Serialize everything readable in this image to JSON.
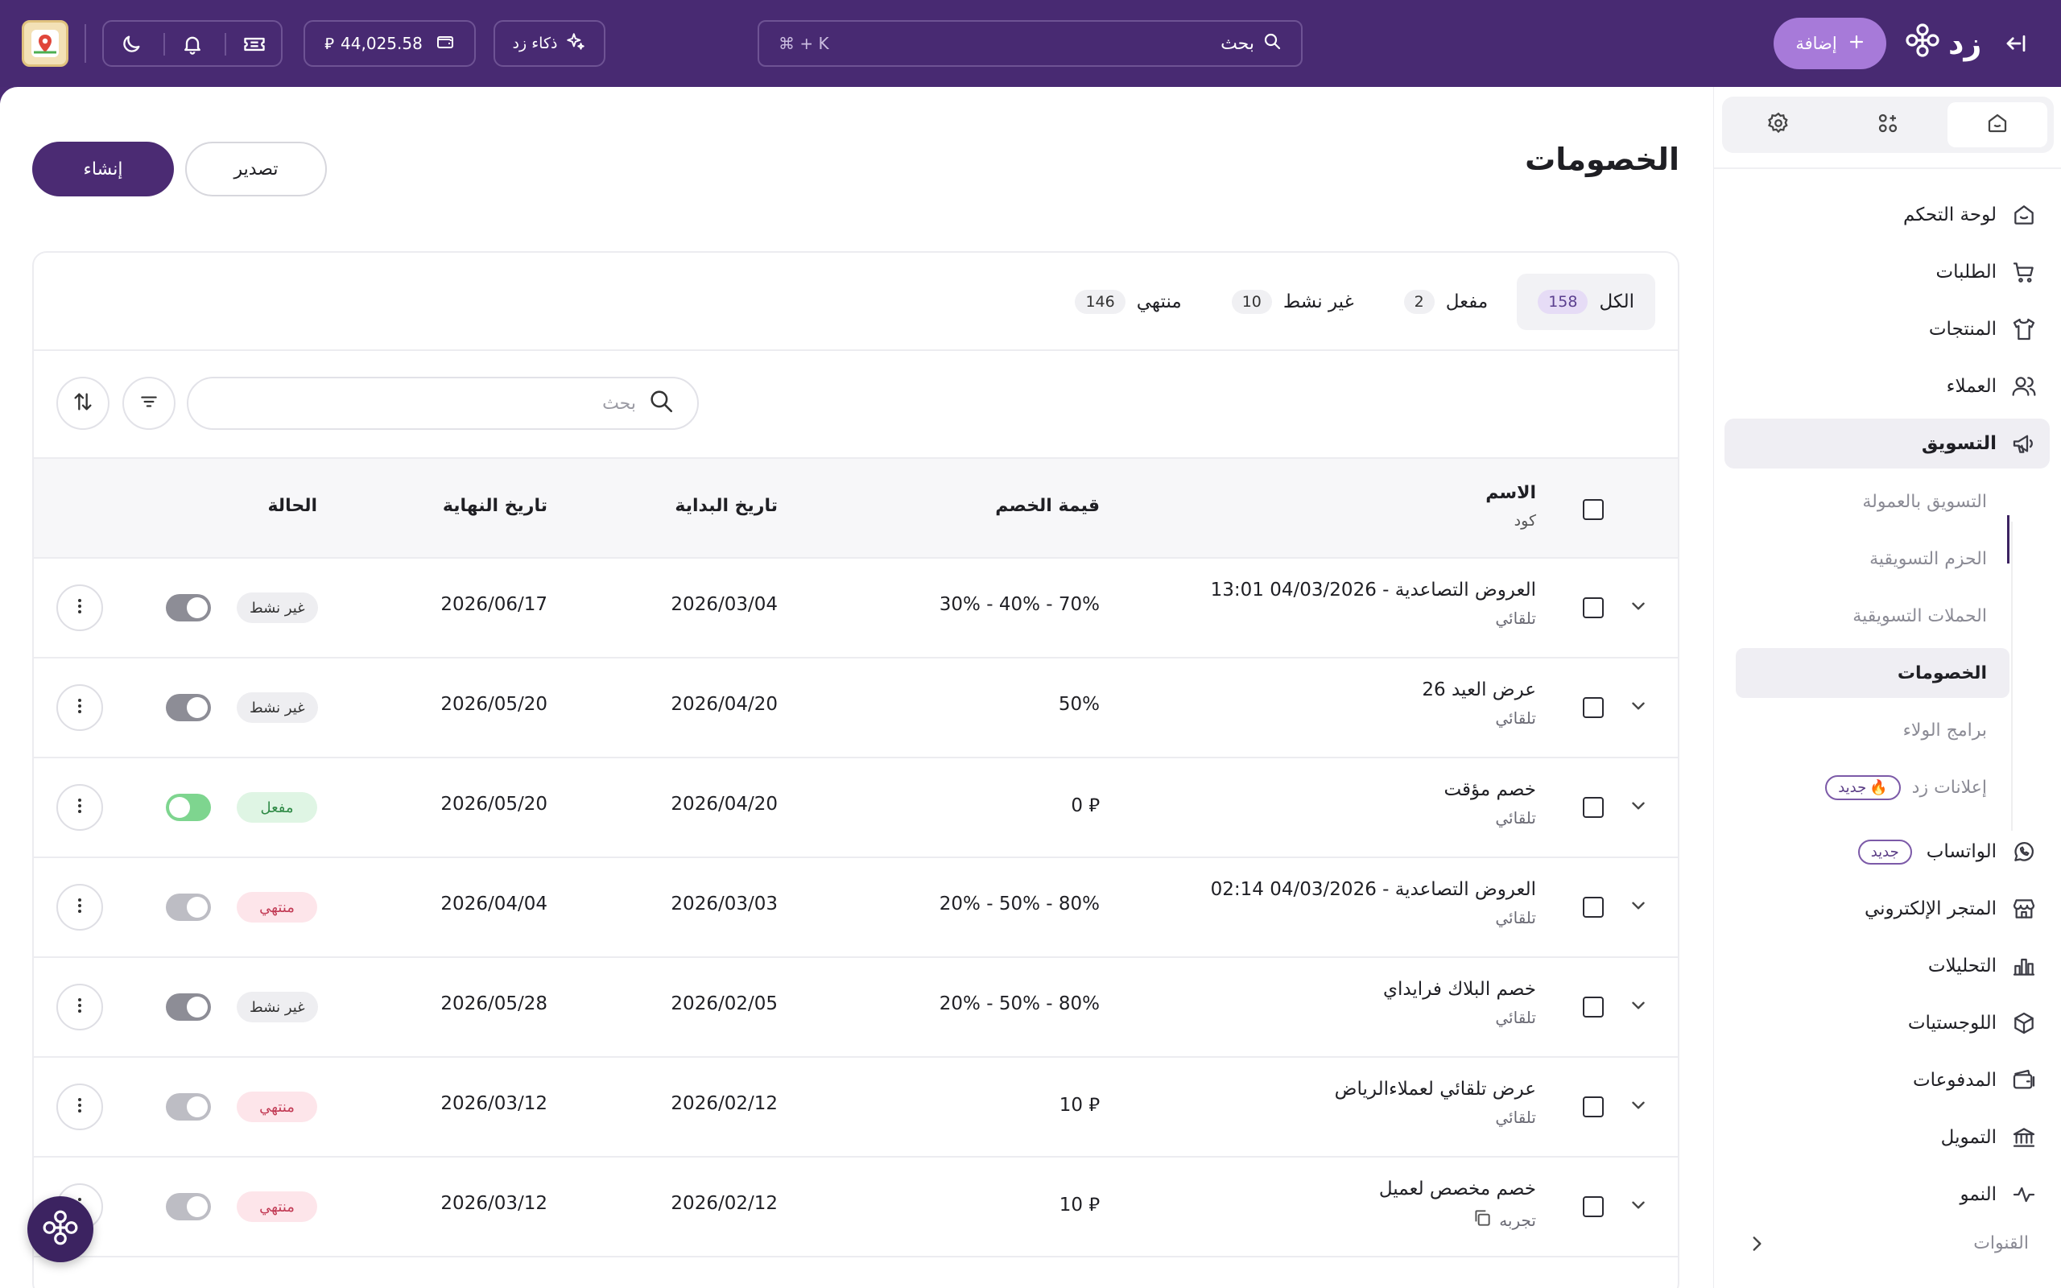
{
  "topbar": {
    "add_label": "إضافة",
    "logo_text": "زد",
    "search_label": "بحث",
    "search_hint": "⌘ + K",
    "ai_label": "ذكاء زد",
    "balance": "44,025.58",
    "currency_symbol": "⃁"
  },
  "sidebar": {
    "nav": [
      {
        "label": "لوحة التحكم",
        "icon": "home-icon"
      },
      {
        "label": "الطلبات",
        "icon": "cart-icon"
      },
      {
        "label": "المنتجات",
        "icon": "shirt-icon"
      },
      {
        "label": "العملاء",
        "icon": "users-icon"
      },
      {
        "label": "التسويق",
        "icon": "megaphone-icon"
      }
    ],
    "sub": [
      {
        "label": "التسويق بالعمولة"
      },
      {
        "label": "الحزم التسويقية"
      },
      {
        "label": "الحملات التسويقية"
      },
      {
        "label": "الخصومات"
      },
      {
        "label": "برامج الولاء"
      },
      {
        "label": "إعلانات زد",
        "badge": "جديد"
      }
    ],
    "nav2": [
      {
        "label": "الواتساب",
        "icon": "whatsapp-icon",
        "badge": "جديد"
      },
      {
        "label": "المتجر الإلكتروني",
        "icon": "store-icon"
      },
      {
        "label": "التحليلات",
        "icon": "chart-icon"
      },
      {
        "label": "اللوجستيات",
        "icon": "box-icon"
      },
      {
        "label": "المدفوعات",
        "icon": "payments-icon"
      },
      {
        "label": "التمويل",
        "icon": "bank-icon"
      },
      {
        "label": "النمو",
        "icon": "growth-icon"
      }
    ],
    "channels_label": "القنوات"
  },
  "page": {
    "title": "الخصومات",
    "create_label": "إنشاء",
    "export_label": "تصدير"
  },
  "filters": [
    {
      "label": "الكل",
      "count": "158"
    },
    {
      "label": "مفعل",
      "count": "2"
    },
    {
      "label": "غير نشط",
      "count": "10"
    },
    {
      "label": "منتهي",
      "count": "146"
    }
  ],
  "table_search_placeholder": "بحث",
  "columns": {
    "name": "الاسم",
    "code": "كود",
    "value": "قيمة الخصم",
    "start": "تاريخ البداية",
    "end": "تاريخ النهاية",
    "status": "الحالة"
  },
  "rows": [
    {
      "name": "العروض التصاعدية - 04/03/2026 13:01",
      "code": "تلقائي",
      "value": "30% - 40% - 70%",
      "start": "2026/03/04",
      "end": "2026/06/17",
      "status": "غير نشط",
      "status_kind": "inactive",
      "toggle": "off"
    },
    {
      "name": "عرض العيد 26",
      "code": "تلقائي",
      "value": "50%",
      "start": "2026/04/20",
      "end": "2026/05/20",
      "status": "غير نشط",
      "status_kind": "inactive",
      "toggle": "off"
    },
    {
      "name": "خصم مؤقت",
      "code": "تلقائي",
      "value": "0 ⃁",
      "start": "2026/04/20",
      "end": "2026/05/20",
      "status": "مفعل",
      "status_kind": "active",
      "toggle": "on"
    },
    {
      "name": "العروض التصاعدية - 04/03/2026 02:14",
      "code": "تلقائي",
      "value": "20% - 50% - 80%",
      "start": "2026/03/03",
      "end": "2026/04/04",
      "status": "منتهي",
      "status_kind": "ended",
      "toggle": "dim"
    },
    {
      "name": "خصم البلاك فرايداي",
      "code": "تلقائي",
      "value": "20% - 50% - 80%",
      "start": "2026/02/05",
      "end": "2026/05/28",
      "status": "غير نشط",
      "status_kind": "inactive",
      "toggle": "off"
    },
    {
      "name": "عرض تلقائي لعملاءالرياض",
      "code": "تلقائي",
      "value": "10 ⃁",
      "start": "2026/02/12",
      "end": "2026/03/12",
      "status": "منتهي",
      "status_kind": "ended",
      "toggle": "dim"
    },
    {
      "name": "خصم مخصص لعميل",
      "code": "تجربه",
      "value": "10 ⃁",
      "start": "2026/02/12",
      "end": "2026/03/12",
      "status": "منتهي",
      "status_kind": "ended",
      "toggle": "dim",
      "copy_icon": true
    }
  ],
  "colors": {
    "brand": "#482a72",
    "accent": "#a77ad9"
  }
}
